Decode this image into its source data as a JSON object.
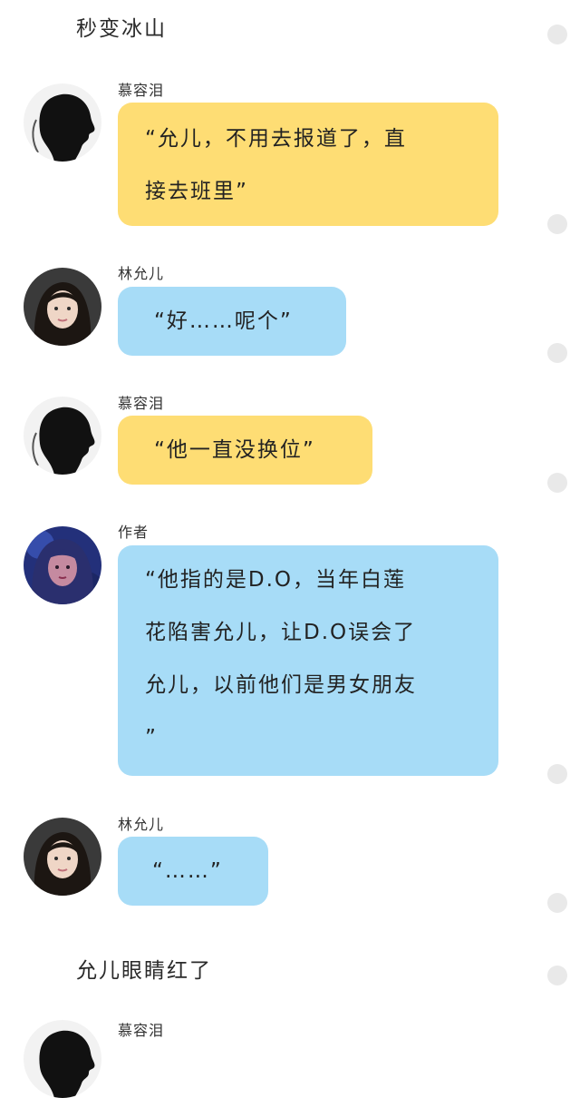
{
  "story": {
    "narration_top": "秒变冰山",
    "messages": [
      {
        "sender": "慕容泪",
        "text": "“允儿，不用去报道了，直\n接去班里”",
        "avatar": "silhouette-avatar",
        "bubble_color": "#fedd74"
      },
      {
        "sender": "林允儿",
        "text": "“好……呢个”",
        "avatar": "portrait-avatar",
        "bubble_color": "#a7dcf7"
      },
      {
        "sender": "慕容泪",
        "text": "“他一直没换位”",
        "avatar": "silhouette-avatar",
        "bubble_color": "#fedd74"
      },
      {
        "sender": "作者",
        "text": "“他指的是D.O，当年白莲\n花陷害允儿，让D.O误会了\n允儿，以前他们是男女朋友\n”",
        "avatar": "author-avatar",
        "bubble_color": "#a7dcf7"
      },
      {
        "sender": "林允儿",
        "text": "“……”",
        "avatar": "portrait-avatar",
        "bubble_color": "#a7dcf7"
      }
    ],
    "narration_bottom": "允儿眼睛红了",
    "next_sender": "慕容泪"
  }
}
